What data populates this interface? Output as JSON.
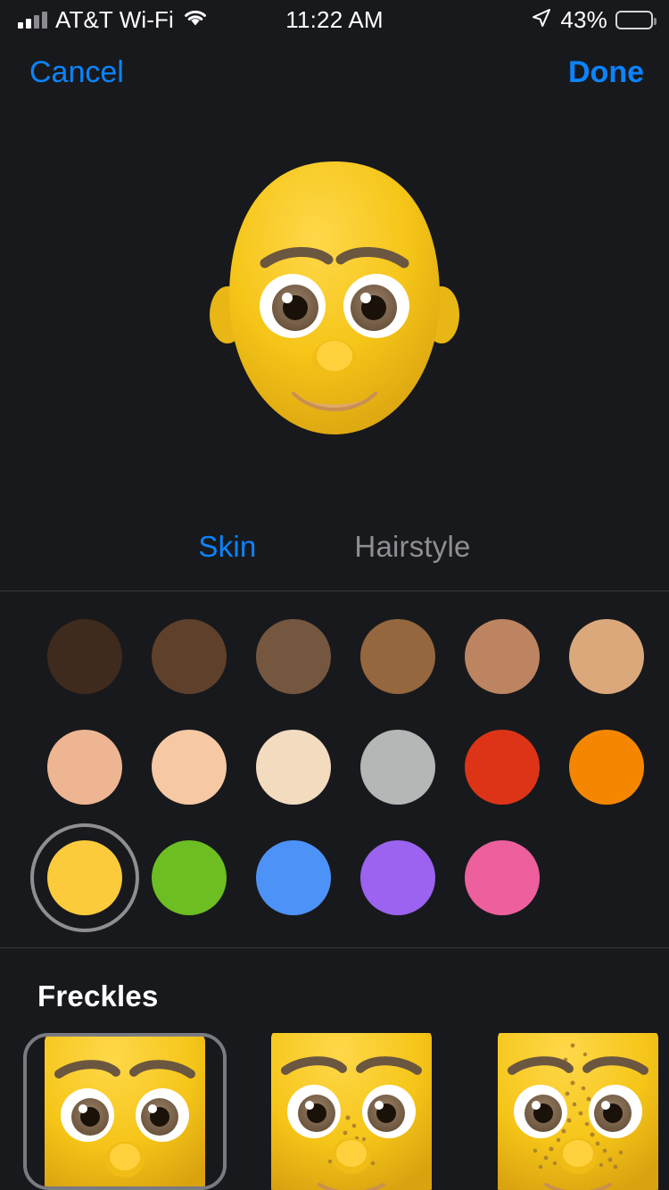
{
  "status_bar": {
    "carrier": "AT&T Wi-Fi",
    "wifi_icon": "wifi-icon",
    "signal_icon": "cellular-signal-icon",
    "time": "11:22 AM",
    "location_icon": "location-arrow-icon",
    "battery_percent": "43%",
    "battery_icon": "battery-low-power-icon",
    "battery_color": "#fcd535"
  },
  "nav": {
    "cancel_label": "Cancel",
    "done_label": "Done",
    "accent_color": "#0a84ff"
  },
  "preview": {
    "avatar_name": "memoji-avatar-preview",
    "skin_color": "#f5c518",
    "skin_shadow": "#e0a800",
    "brow_color": "#6b5640",
    "iris_color": "#7a6450",
    "mouth_color": "#e0a86a"
  },
  "tabs": [
    {
      "label": "Skin",
      "active": true
    },
    {
      "label": "Hairstyle",
      "active": false
    }
  ],
  "skin_swatches": {
    "selected_index": 12,
    "selection_ring_color": "#8e8e93",
    "rows": [
      [
        {
          "name": "dark-brown",
          "color": "#3f2b1d"
        },
        {
          "name": "brown",
          "color": "#5e402b"
        },
        {
          "name": "medium-brown",
          "color": "#755740"
        },
        {
          "name": "tan-brown",
          "color": "#94673f"
        },
        {
          "name": "light-brown",
          "color": "#bc8460"
        },
        {
          "name": "tan",
          "color": "#dba87c"
        }
      ],
      [
        {
          "name": "light-tan",
          "color": "#eeb592"
        },
        {
          "name": "peach",
          "color": "#f6c9a4"
        },
        {
          "name": "cream",
          "color": "#f3dbc0"
        },
        {
          "name": "gray",
          "color": "#b3b7b6"
        },
        {
          "name": "red",
          "color": "#dd3317"
        },
        {
          "name": "orange",
          "color": "#f58700"
        }
      ],
      [
        {
          "name": "yellow",
          "color": "#fbcb3c"
        },
        {
          "name": "green",
          "color": "#6cbe22"
        },
        {
          "name": "blue",
          "color": "#4d92f7"
        },
        {
          "name": "purple",
          "color": "#9b63f0"
        },
        {
          "name": "pink",
          "color": "#ee5f9e"
        }
      ]
    ]
  },
  "freckles": {
    "title": "Freckles",
    "selected_index": 0,
    "options": [
      {
        "name": "freckles-none",
        "density": 0
      },
      {
        "name": "freckles-light",
        "density": 1
      },
      {
        "name": "freckles-heavy",
        "density": 2
      }
    ]
  }
}
